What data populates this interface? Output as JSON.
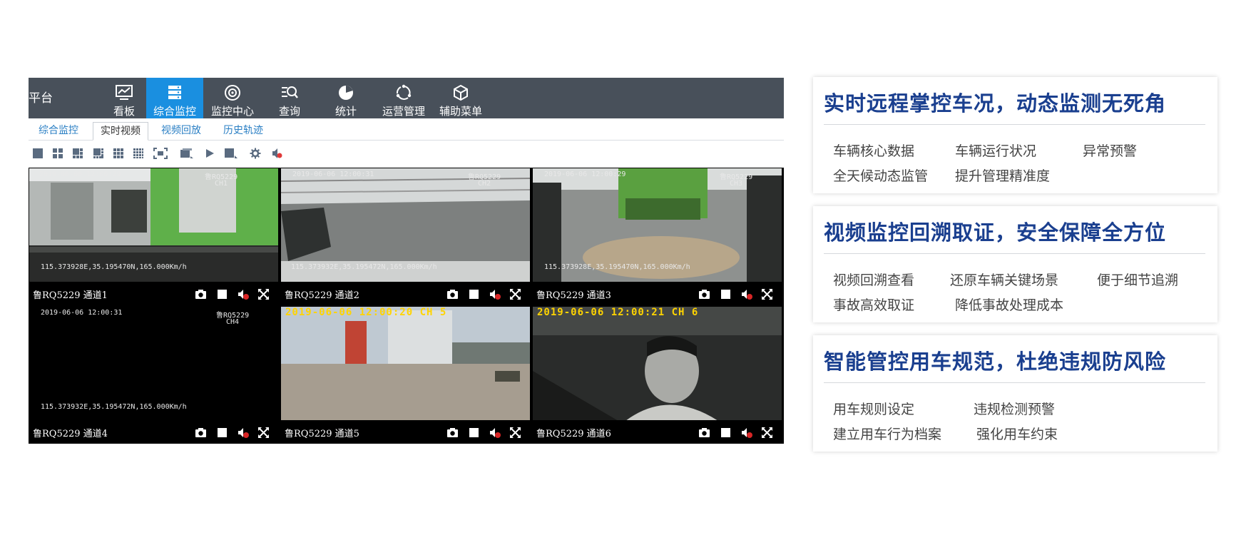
{
  "app": {
    "brand": "平台",
    "nav": [
      {
        "label": "看板",
        "icon": "chart-board-icon",
        "active": false
      },
      {
        "label": "综合监控",
        "icon": "monitor-stack-icon",
        "active": true
      },
      {
        "label": "监控中心",
        "icon": "target-icon",
        "active": false
      },
      {
        "label": "查询",
        "icon": "search-list-icon",
        "active": false
      },
      {
        "label": "统计",
        "icon": "pie-chart-icon",
        "active": false
      },
      {
        "label": "运营管理",
        "icon": "cycle-icon",
        "active": false
      },
      {
        "label": "辅助菜单",
        "icon": "cube-icon",
        "active": false
      }
    ],
    "subtabs": [
      {
        "label": "综合监控",
        "active": false
      },
      {
        "label": "实时视频",
        "active": true
      },
      {
        "label": "视频回放",
        "active": false
      },
      {
        "label": "历史轨迹",
        "active": false
      }
    ],
    "toolbar": [
      "layout-1-icon",
      "layout-4-icon",
      "layout-6-icon",
      "layout-8-icon",
      "layout-9-icon",
      "layout-16-icon",
      "fullscreen-icon",
      "stream-icon",
      "play-icon",
      "record-icon",
      "settings-icon",
      "audio-icon"
    ],
    "channels": [
      {
        "label": "鲁RQ5229 通道1",
        "osd_time": "2019-06-06 12:00:29",
        "osd_plate": "鲁RQ5229",
        "osd_ch": "CH1",
        "osd_gps": "115.373928E,35.195470N,165.000Km/h"
      },
      {
        "label": "鲁RQ5229 通道2",
        "osd_time": "2019-06-06 12:00:31",
        "osd_plate": "鲁RQ5229",
        "osd_ch": "CH2",
        "osd_gps": "115.373932E,35.195472N,165.000Km/h"
      },
      {
        "label": "鲁RQ5229 通道3",
        "osd_time": "2019-06-06 12:00:29",
        "osd_plate": "鲁RQ5229",
        "osd_ch": "CH3",
        "osd_gps": "115.373928E,35.195470N,165.000Km/h"
      },
      {
        "label": "鲁RQ5229 通道4",
        "osd_time": "2019-06-06 12:00:31",
        "osd_plate": "鲁RQ5229",
        "osd_ch": "CH4",
        "osd_gps": "115.373932E,35.195472N,165.000Km/h"
      },
      {
        "label": "鲁RQ5229 通道5",
        "osd_time": "2019-06-06 12:00:20 CH 5"
      },
      {
        "label": "鲁RQ5229 通道6",
        "osd_time": "2019-06-06 12:00:21 CH 6"
      }
    ]
  },
  "features": [
    {
      "title": "实时远程掌控车况，动态监测无死角",
      "tags": [
        "车辆核心数据",
        "车辆运行状况",
        "异常预警",
        "全天候动态监管",
        "提升管理精准度"
      ]
    },
    {
      "title": "视频监控回溯取证，安全保障全方位",
      "tags": [
        "视频回溯查看",
        "还原车辆关键场景",
        "便于细节追溯",
        "事故高效取证",
        "降低事故处理成本"
      ]
    },
    {
      "title": "智能管控用车规范，杜绝违规防风险",
      "tags": [
        "用车规则设定",
        "违规检测预警",
        "建立用车行为档案",
        "强化用车约束"
      ]
    }
  ]
}
